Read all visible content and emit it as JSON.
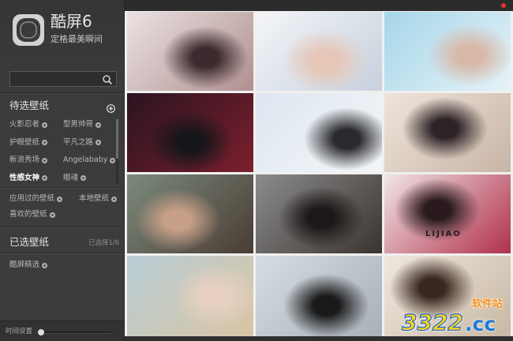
{
  "window": {
    "close_color": "#e5322d",
    "close_icon": "close-dot-icon",
    "sidebar_color": "#3b3b3b",
    "topbar_color": "#2c2c2c"
  },
  "app": {
    "name": "酷屏6",
    "tagline": "定格最美瞬间",
    "logo_icon": "kuping-logo-icon"
  },
  "search": {
    "value": "",
    "icon": "search-icon"
  },
  "candidates": {
    "title": "待选壁纸",
    "add_icon": "plus-circle-icon",
    "categories": [
      {
        "label": "火影忍者"
      },
      {
        "label": "型男帅哥"
      },
      {
        "label": "护眼壁纸"
      },
      {
        "label": "平凡之路"
      },
      {
        "label": "新浪秀场"
      },
      {
        "label": "Angelababy"
      },
      {
        "label": "性感女神",
        "active": true
      },
      {
        "label": "眼魂"
      }
    ]
  },
  "library": {
    "items": [
      {
        "label": "应用过的壁纸"
      },
      {
        "label": "本地壁纸"
      },
      {
        "label": "喜欢的壁纸"
      }
    ]
  },
  "selected": {
    "title": "已选壁纸",
    "count_text": "已选择1/6",
    "items": [
      {
        "label": "酷屏精选"
      }
    ]
  },
  "timer": {
    "label": "时间设置",
    "level": 0
  },
  "thumbnails": [
    {
      "colors": [
        "#ebe1e2",
        "#b0908f"
      ],
      "accent": "#3b2b2e"
    },
    {
      "colors": [
        "#f4f5f8",
        "#c6d1dd"
      ],
      "accent": "#e6c6b6"
    },
    {
      "colors": [
        "#a6d6e9",
        "#e6f3f8"
      ],
      "accent": "#d8b8a8"
    },
    {
      "colors": [
        "#2a1420",
        "#7c1f2d"
      ],
      "accent": "#16161a"
    },
    {
      "colors": [
        "#dde7f0",
        "#f4f6f8"
      ],
      "accent": "#2a2a2e"
    },
    {
      "colors": [
        "#efe4da",
        "#c8b4a5"
      ],
      "accent": "#2e2428"
    },
    {
      "colors": [
        "#7b8a7c",
        "#4a3c34"
      ],
      "accent": "#c8a088"
    },
    {
      "colors": [
        "#8c8c8c",
        "#3a3430"
      ],
      "accent": "#1c1818"
    },
    {
      "colors": [
        "#f0e6e6",
        "#b0304a"
      ],
      "accent": "#2a1a1e",
      "caption": "LIJIAO"
    },
    {
      "colors": [
        "#b8cdd6",
        "#d9c5a4"
      ],
      "accent": "#e8d0c0"
    },
    {
      "colors": [
        "#d6dde3",
        "#a8b0b8"
      ],
      "accent": "#1a1a1a"
    },
    {
      "colors": [
        "#efe7de",
        "#c8b8a4"
      ],
      "accent": "#3a2820"
    }
  ],
  "watermark": {
    "number": "3322",
    "domain": ".cc",
    "label": "软件站"
  }
}
